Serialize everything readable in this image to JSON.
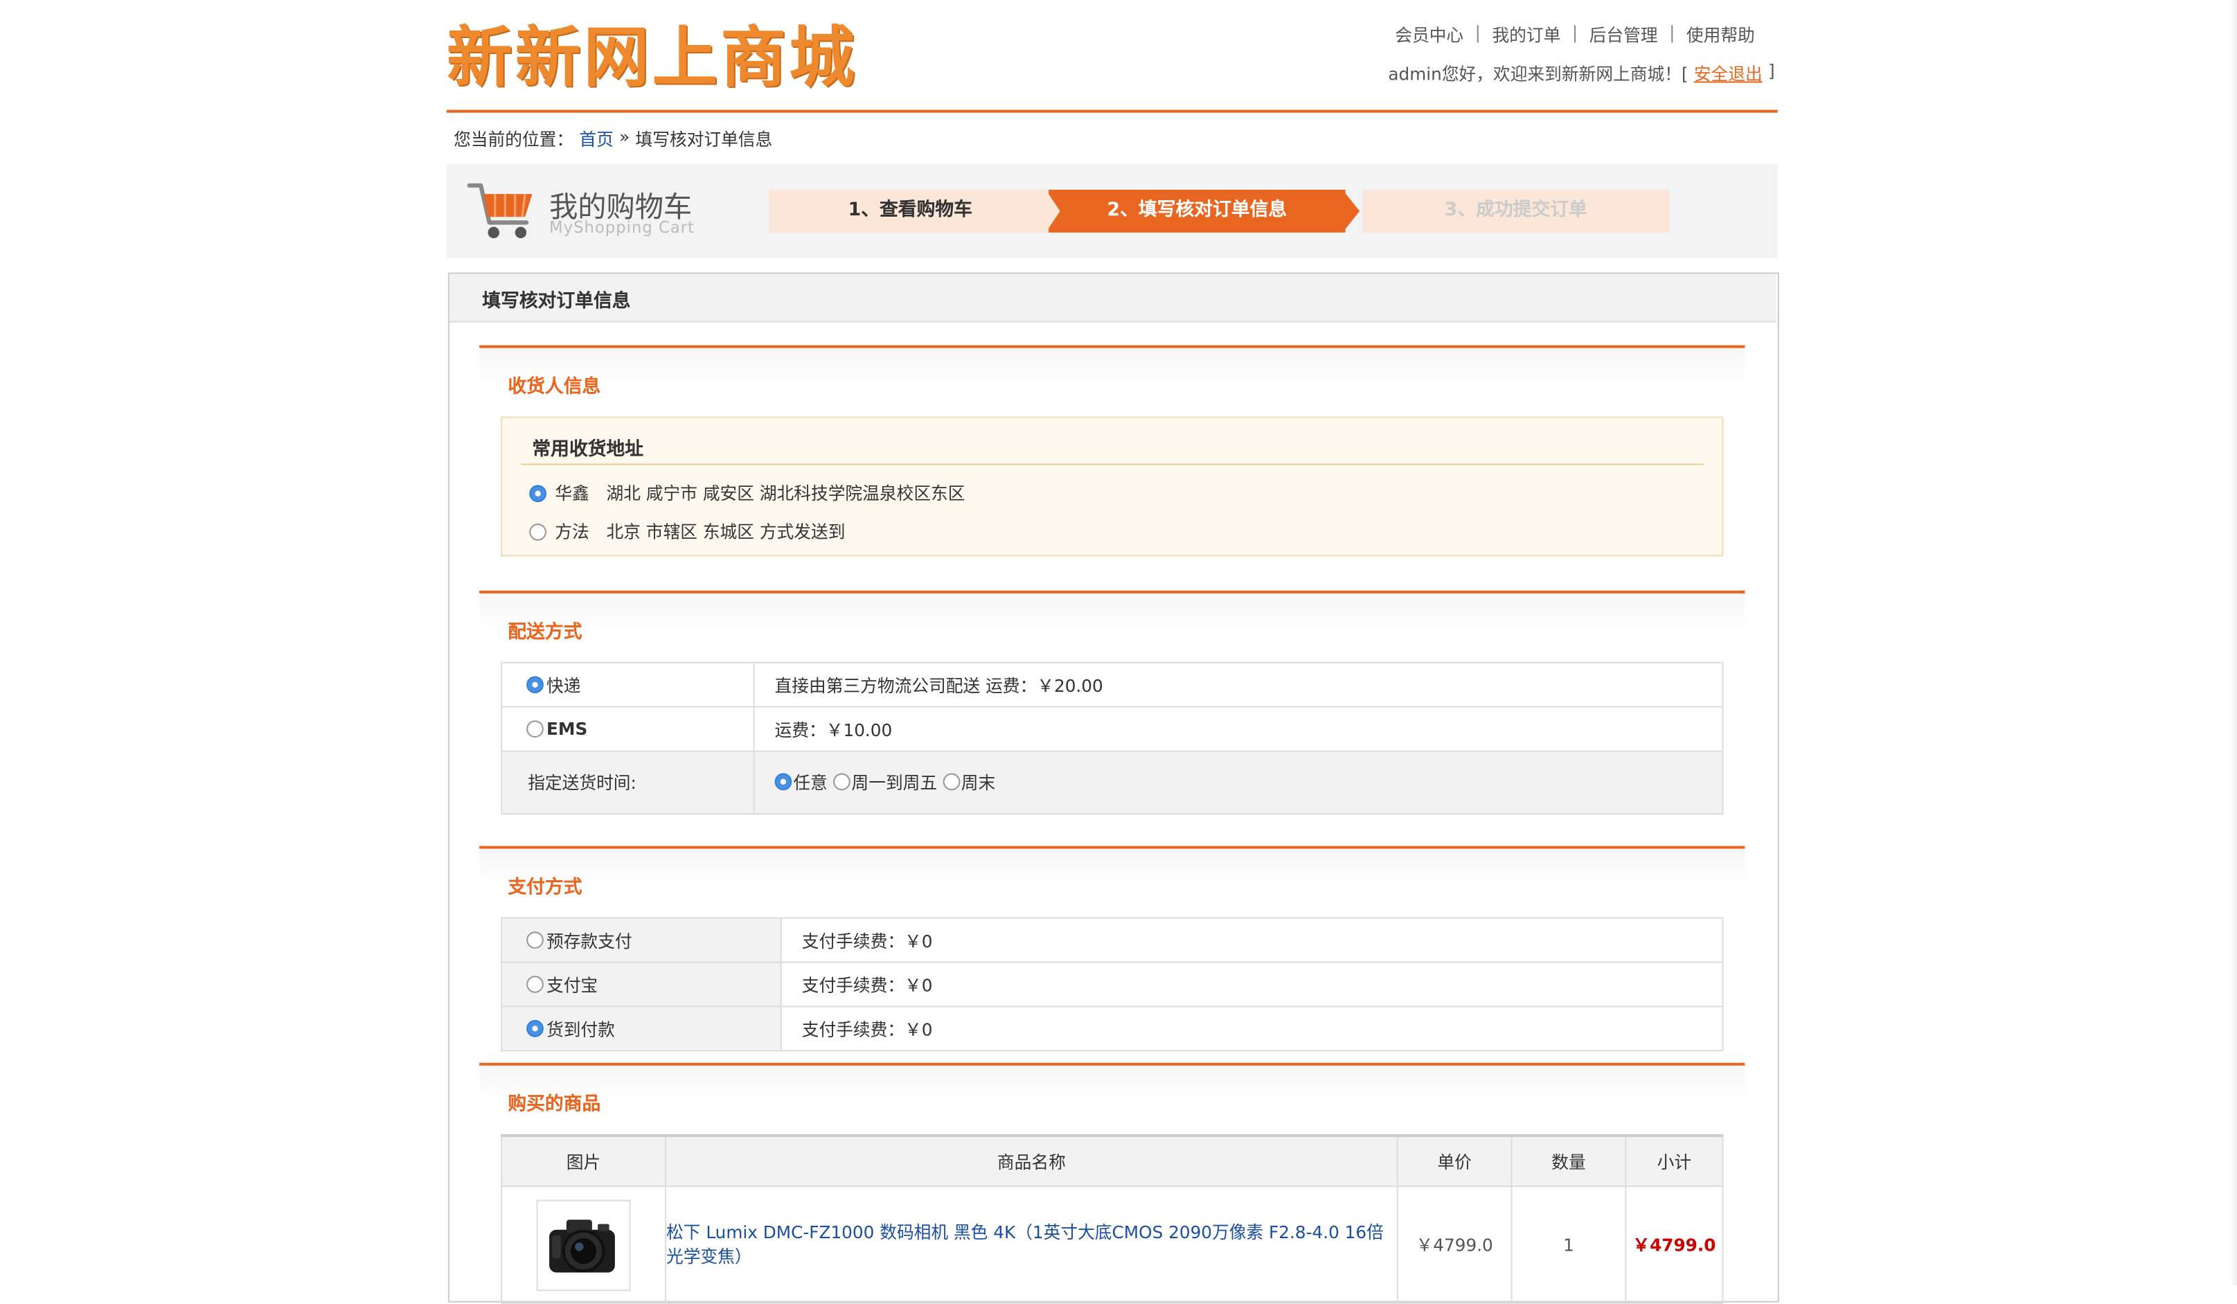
{
  "header": {
    "logo": "新新网上商城",
    "nav": [
      "会员中心",
      "我的订单",
      "后台管理",
      "使用帮助"
    ],
    "nav_sep": "|",
    "welcome": "admin您好，欢迎来到新新网上商城！[",
    "logout": "安全退出",
    "welcome_end": "]"
  },
  "breadcrumb": {
    "prefix": "您当前的位置：",
    "home": "首页",
    "sep": "»",
    "current": "填写核对订单信息"
  },
  "cart": {
    "title": "我的购物车",
    "subtitle": "MyShopping Cart",
    "steps": [
      "1、查看购物车",
      "2、填写核对订单信息",
      "3、成功提交订单"
    ],
    "active_step": 2
  },
  "panel": {
    "title": "填写核对订单信息"
  },
  "receiver": {
    "section_title": "收货人信息",
    "box_title": "常用收货地址",
    "addresses": [
      {
        "name": "华鑫",
        "address": "湖北 咸宁市 咸安区 湖北科技学院温泉校区东区",
        "selected": true
      },
      {
        "name": "方法",
        "address": "北京 市辖区 东城区 方式发送到",
        "selected": false
      }
    ]
  },
  "shipping": {
    "section_title": "配送方式",
    "options": [
      {
        "label": "快递",
        "desc": "直接由第三方物流公司配送 运费：￥20.00",
        "selected": true
      },
      {
        "label": "EMS",
        "desc": "运费：￥10.00",
        "selected": false
      }
    ],
    "time_label": "指定送货时间:",
    "time_options": [
      {
        "label": "任意",
        "selected": true
      },
      {
        "label": "周一到周五",
        "selected": false
      },
      {
        "label": "周末",
        "selected": false
      }
    ]
  },
  "payment": {
    "section_title": "支付方式",
    "options": [
      {
        "label": "预存款支付",
        "fee": "支付手续费：￥0",
        "selected": false
      },
      {
        "label": "支付宝",
        "fee": "支付手续费：￥0",
        "selected": false
      },
      {
        "label": "货到付款",
        "fee": "支付手续费：￥0",
        "selected": true
      }
    ]
  },
  "goods": {
    "section_title": "购买的商品",
    "columns": [
      "图片",
      "商品名称",
      "单价",
      "数量",
      "小计"
    ],
    "rows": [
      {
        "name": "松下 Lumix DMC-FZ1000 数码相机 黑色 4K（1英寸大底CMOS 2090万像素 F2.8-4.0 16倍光学变焦）",
        "price": "￥4799.0",
        "qty": "1",
        "subtotal": "￥4799.0"
      }
    ]
  }
}
